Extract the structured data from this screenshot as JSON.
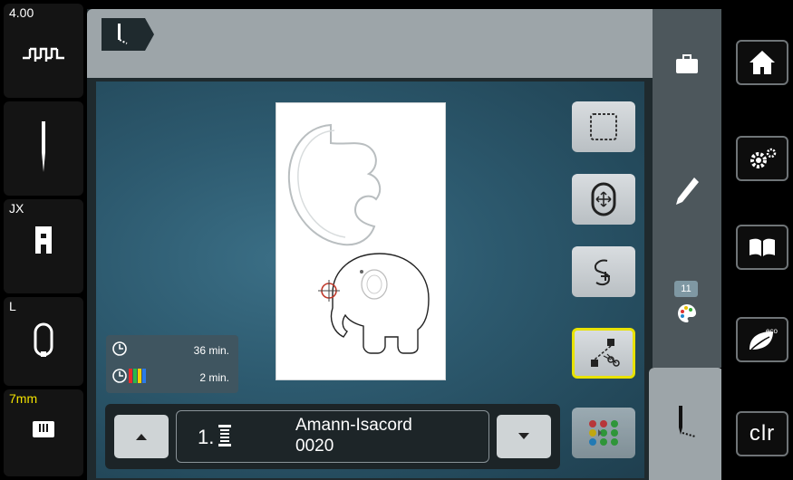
{
  "status": {
    "stitch_length": "4.00",
    "stitch_type_icon": "stitch-pattern-icon",
    "needle_icon": "needle-icon",
    "foot_label": "JX",
    "foot_icon": "presser-foot-icon",
    "hoop_label": "L",
    "hoop_icon": "hoop-icon",
    "plate_label": "7mm",
    "plate_icon": "stitch-plate-icon"
  },
  "tools": [
    {
      "name": "select-frame",
      "icon": "dashed-square-icon"
    },
    {
      "name": "move-hoop",
      "icon": "hoop-move-icon"
    },
    {
      "name": "stitch-path",
      "icon": "stitch-path-icon"
    },
    {
      "name": "jump-stitch-cut",
      "icon": "cut-jump-icon",
      "active": true
    },
    {
      "name": "color-sequence",
      "icon": "color-dots-icon"
    }
  ],
  "info": {
    "total_time": "36 min.",
    "color_time": "2 min."
  },
  "thread": {
    "number": "1.",
    "brand": "Amann-Isacord",
    "code": "0020"
  },
  "side": {
    "color_count": "11"
  },
  "system": {
    "clr_label": "clr"
  },
  "colors": {
    "frame_dark": "#1f2a2e",
    "workarea": "#2d5a6f",
    "accent_yellow": "#e8e200"
  }
}
